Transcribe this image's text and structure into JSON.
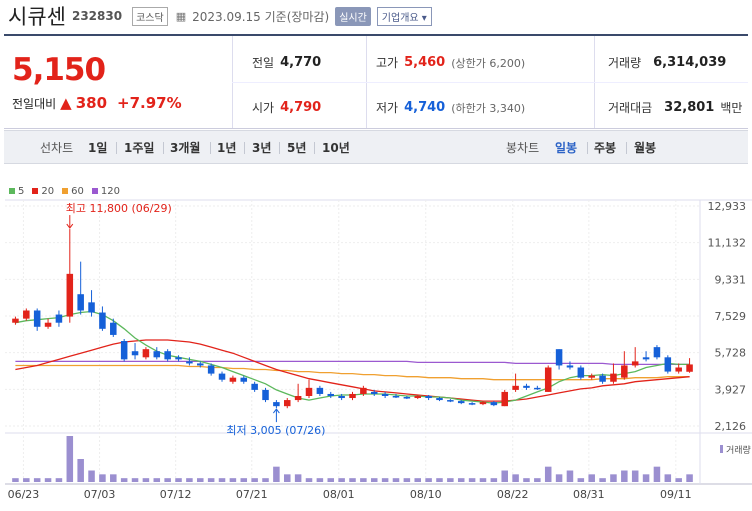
{
  "header": {
    "name": "시큐센",
    "code": "232830",
    "market": "코스닥",
    "datetime": "2023.09.15 기준(장마감)",
    "realtime_label": "실시간",
    "company_info_label": "기업개요"
  },
  "summary": {
    "price": "5,150",
    "prev_label": "전일대비",
    "change": "380",
    "change_pct": "+7.97%",
    "prev_close_label": "전일",
    "prev_close": "4,770",
    "open_label": "시가",
    "open": "4,790",
    "high_label": "고가",
    "high": "5,460",
    "upper_limit": "(상한가 6,200)",
    "low_label": "저가",
    "low": "4,740",
    "lower_limit": "(하한가 3,340)",
    "volume_label": "거래량",
    "volume": "6,314,039",
    "amount_label": "거래대금",
    "amount": "32,801",
    "amount_unit": "백만"
  },
  "periods": {
    "label": "선차트",
    "items": [
      "1일",
      "1주일",
      "3개월",
      "1년",
      "3년",
      "5년",
      "10년"
    ],
    "candle_label": "봉차트",
    "candle_items": [
      "일봉",
      "주봉",
      "월봉"
    ],
    "active_candle": "일봉"
  },
  "colors": {
    "up": "#e2231a",
    "down": "#1560d8",
    "ma5": "#5cb85c",
    "ma20": "#e2231a",
    "ma60": "#f0a030",
    "ma120": "#9b59d0",
    "volume": "#9b8fd0"
  },
  "chart_data": {
    "type": "candlestick",
    "ma_legend": [
      "5",
      "20",
      "60",
      "120"
    ],
    "y_ticks": [
      "12,933",
      "11,132",
      "9,331",
      "7,529",
      "5,728",
      "3,927",
      "2,126"
    ],
    "ylim": [
      2126,
      12933
    ],
    "x_ticks": [
      "06/23",
      "07/03",
      "07/12",
      "07/21",
      "08/01",
      "08/10",
      "08/22",
      "08/31",
      "09/11"
    ],
    "volume_label": "거래량",
    "annotation_high": "최고 11,800 (06/29)",
    "annotation_low": "최저 3,005 (07/26)",
    "candles": [
      {
        "o": 7200,
        "c": 7400,
        "h": 7500,
        "l": 7100
      },
      {
        "o": 7400,
        "c": 7800,
        "h": 7900,
        "l": 7300
      },
      {
        "o": 7800,
        "c": 7000,
        "h": 7900,
        "l": 6800
      },
      {
        "o": 7000,
        "c": 7200,
        "h": 7400,
        "l": 6900
      },
      {
        "o": 7600,
        "c": 7200,
        "h": 7800,
        "l": 7000
      },
      {
        "o": 7500,
        "c": 9600,
        "h": 11800,
        "l": 7200
      },
      {
        "o": 8600,
        "c": 7800,
        "h": 10200,
        "l": 7600
      },
      {
        "o": 8200,
        "c": 7700,
        "h": 8800,
        "l": 7500
      },
      {
        "o": 7700,
        "c": 6900,
        "h": 8000,
        "l": 6800
      },
      {
        "o": 7200,
        "c": 6600,
        "h": 7400,
        "l": 6500
      },
      {
        "o": 6300,
        "c": 5400,
        "h": 6400,
        "l": 5300
      },
      {
        "o": 5800,
        "c": 5600,
        "h": 6200,
        "l": 5400
      },
      {
        "o": 5500,
        "c": 5900,
        "h": 6000,
        "l": 5400
      },
      {
        "o": 5800,
        "c": 5500,
        "h": 6000,
        "l": 5400
      },
      {
        "o": 5800,
        "c": 5400,
        "h": 5900,
        "l": 5300
      },
      {
        "o": 5500,
        "c": 5400,
        "h": 5600,
        "l": 5300
      },
      {
        "o": 5300,
        "c": 5200,
        "h": 5500,
        "l": 5100
      },
      {
        "o": 5200,
        "c": 5100,
        "h": 5300,
        "l": 5000
      },
      {
        "o": 5100,
        "c": 4700,
        "h": 5200,
        "l": 4600
      },
      {
        "o": 4700,
        "c": 4400,
        "h": 4800,
        "l": 4300
      },
      {
        "o": 4300,
        "c": 4500,
        "h": 4600,
        "l": 4200
      },
      {
        "o": 4500,
        "c": 4300,
        "h": 4600,
        "l": 4200
      },
      {
        "o": 4200,
        "c": 3900,
        "h": 4300,
        "l": 3800
      },
      {
        "o": 3900,
        "c": 3400,
        "h": 4000,
        "l": 3300
      },
      {
        "o": 3300,
        "c": 3100,
        "h": 3400,
        "l": 3005
      },
      {
        "o": 3100,
        "c": 3400,
        "h": 3500,
        "l": 3000
      },
      {
        "o": 3400,
        "c": 3600,
        "h": 4200,
        "l": 3300
      },
      {
        "o": 3600,
        "c": 4000,
        "h": 4400,
        "l": 3500
      },
      {
        "o": 4000,
        "c": 3700,
        "h": 4100,
        "l": 3600
      },
      {
        "o": 3700,
        "c": 3600,
        "h": 3800,
        "l": 3500
      },
      {
        "o": 3600,
        "c": 3500,
        "h": 3700,
        "l": 3400
      },
      {
        "o": 3500,
        "c": 3700,
        "h": 3800,
        "l": 3400
      },
      {
        "o": 3700,
        "c": 4000,
        "h": 4100,
        "l": 3600
      },
      {
        "o": 3800,
        "c": 3700,
        "h": 3900,
        "l": 3600
      },
      {
        "o": 3700,
        "c": 3600,
        "h": 3800,
        "l": 3500
      },
      {
        "o": 3600,
        "c": 3550,
        "h": 3700,
        "l": 3500
      },
      {
        "o": 3550,
        "c": 3500,
        "h": 3600,
        "l": 3450
      },
      {
        "o": 3500,
        "c": 3600,
        "h": 3650,
        "l": 3450
      },
      {
        "o": 3600,
        "c": 3500,
        "h": 3650,
        "l": 3400
      },
      {
        "o": 3500,
        "c": 3400,
        "h": 3550,
        "l": 3350
      },
      {
        "o": 3400,
        "c": 3350,
        "h": 3450,
        "l": 3300
      },
      {
        "o": 3350,
        "c": 3250,
        "h": 3400,
        "l": 3200
      },
      {
        "o": 3250,
        "c": 3200,
        "h": 3300,
        "l": 3150
      },
      {
        "o": 3200,
        "c": 3300,
        "h": 3350,
        "l": 3150
      },
      {
        "o": 3300,
        "c": 3150,
        "h": 3350,
        "l": 3100
      },
      {
        "o": 3100,
        "c": 3800,
        "h": 3900,
        "l": 3100
      },
      {
        "o": 3900,
        "c": 4100,
        "h": 4700,
        "l": 3800
      },
      {
        "o": 4100,
        "c": 4000,
        "h": 4200,
        "l": 3900
      },
      {
        "o": 4000,
        "c": 3950,
        "h": 4100,
        "l": 3900
      },
      {
        "o": 3800,
        "c": 5000,
        "h": 5100,
        "l": 3800
      },
      {
        "o": 5900,
        "c": 5100,
        "h": 5900,
        "l": 4900
      },
      {
        "o": 5100,
        "c": 5000,
        "h": 5300,
        "l": 4900
      },
      {
        "o": 5000,
        "c": 4500,
        "h": 5100,
        "l": 4400
      },
      {
        "o": 4500,
        "c": 4600,
        "h": 4700,
        "l": 4400
      },
      {
        "o": 4600,
        "c": 4300,
        "h": 4700,
        "l": 4200
      },
      {
        "o": 4300,
        "c": 4700,
        "h": 5200,
        "l": 4200
      },
      {
        "o": 4500,
        "c": 5100,
        "h": 5800,
        "l": 4400
      },
      {
        "o": 5100,
        "c": 5300,
        "h": 6000,
        "l": 5000
      },
      {
        "o": 5500,
        "c": 5400,
        "h": 5800,
        "l": 5300
      },
      {
        "o": 6000,
        "c": 5500,
        "h": 6100,
        "l": 5400
      },
      {
        "o": 5500,
        "c": 4800,
        "h": 5600,
        "l": 4700
      },
      {
        "o": 4800,
        "c": 5000,
        "h": 5200,
        "l": 4700
      },
      {
        "o": 4790,
        "c": 5150,
        "h": 5460,
        "l": 4740
      }
    ],
    "ma5": [
      7200,
      7300,
      7350,
      7400,
      7450,
      7600,
      7700,
      7750,
      7600,
      7300,
      6900,
      6450,
      6100,
      5800,
      5600,
      5500,
      5400,
      5300,
      5150,
      5000,
      4800,
      4600,
      4400,
      4200,
      3900,
      3700,
      3500,
      3400,
      3500,
      3600,
      3650,
      3650,
      3700,
      3700,
      3700,
      3650,
      3600,
      3600,
      3550,
      3550,
      3500,
      3400,
      3350,
      3300,
      3250,
      3300,
      3400,
      3600,
      3800,
      4000,
      4300,
      4500,
      4600,
      4600,
      4650,
      4600,
      4700,
      4800,
      5000,
      5100,
      5200,
      5150,
      5150
    ],
    "ma20": [
      4900,
      5000,
      5100,
      5250,
      5400,
      5550,
      5700,
      5850,
      6000,
      6150,
      6250,
      6300,
      6350,
      6350,
      6350,
      6300,
      6250,
      6150,
      6000,
      5850,
      5700,
      5500,
      5300,
      5100,
      4900,
      4750,
      4600,
      4450,
      4350,
      4250,
      4150,
      4050,
      3950,
      3850,
      3800,
      3750,
      3700,
      3650,
      3600,
      3550,
      3500,
      3450,
      3400,
      3350,
      3350,
      3350,
      3400,
      3450,
      3550,
      3650,
      3750,
      3850,
      3950,
      4000,
      4100,
      4150,
      4200,
      4300,
      4350,
      4400,
      4450,
      4500,
      4550
    ],
    "ma60": [
      5100,
      5100,
      5100,
      5100,
      5100,
      5100,
      5100,
      5100,
      5100,
      5100,
      5100,
      5100,
      5100,
      5100,
      5100,
      5100,
      5050,
      5050,
      5000,
      5000,
      4950,
      4950,
      4900,
      4900,
      4850,
      4850,
      4800,
      4800,
      4750,
      4750,
      4700,
      4700,
      4650,
      4650,
      4600,
      4600,
      4550,
      4550,
      4500,
      4500,
      4500,
      4450,
      4450,
      4450,
      4400,
      4400,
      4400,
      4400,
      4400,
      4400,
      4400,
      4400,
      4400,
      4400,
      4450,
      4450,
      4450,
      4500,
      4500,
      4500,
      4550,
      4550,
      4550
    ],
    "ma120": [
      5300,
      5300,
      5300,
      5300,
      5300,
      5300,
      5300,
      5300,
      5300,
      5300,
      5300,
      5300,
      5300,
      5300,
      5300,
      5300,
      5300,
      5300,
      5300,
      5300,
      5300,
      5300,
      5300,
      5300,
      5300,
      5300,
      5300,
      5300,
      5300,
      5300,
      5300,
      5300,
      5300,
      5300,
      5300,
      5300,
      5300,
      5250,
      5250,
      5250,
      5250,
      5250,
      5250,
      5250,
      5250,
      5250,
      5200,
      5200,
      5200,
      5200,
      5200,
      5200,
      5200,
      5200,
      5200,
      5150,
      5150,
      5150,
      5150,
      5150,
      5150,
      5150,
      5150
    ],
    "volume": [
      1,
      1,
      1,
      1,
      1,
      12,
      6,
      3,
      2,
      2,
      1,
      1,
      1,
      1,
      1,
      1,
      1,
      1,
      1,
      1,
      1,
      1,
      1,
      1,
      4,
      2,
      2,
      1,
      1,
      1,
      1,
      1,
      1,
      1,
      1,
      1,
      1,
      1,
      1,
      1,
      1,
      1,
      1,
      1,
      1,
      3,
      2,
      1,
      1,
      4,
      2,
      3,
      1,
      2,
      1,
      2,
      3,
      3,
      2,
      4,
      2,
      1,
      2
    ]
  }
}
